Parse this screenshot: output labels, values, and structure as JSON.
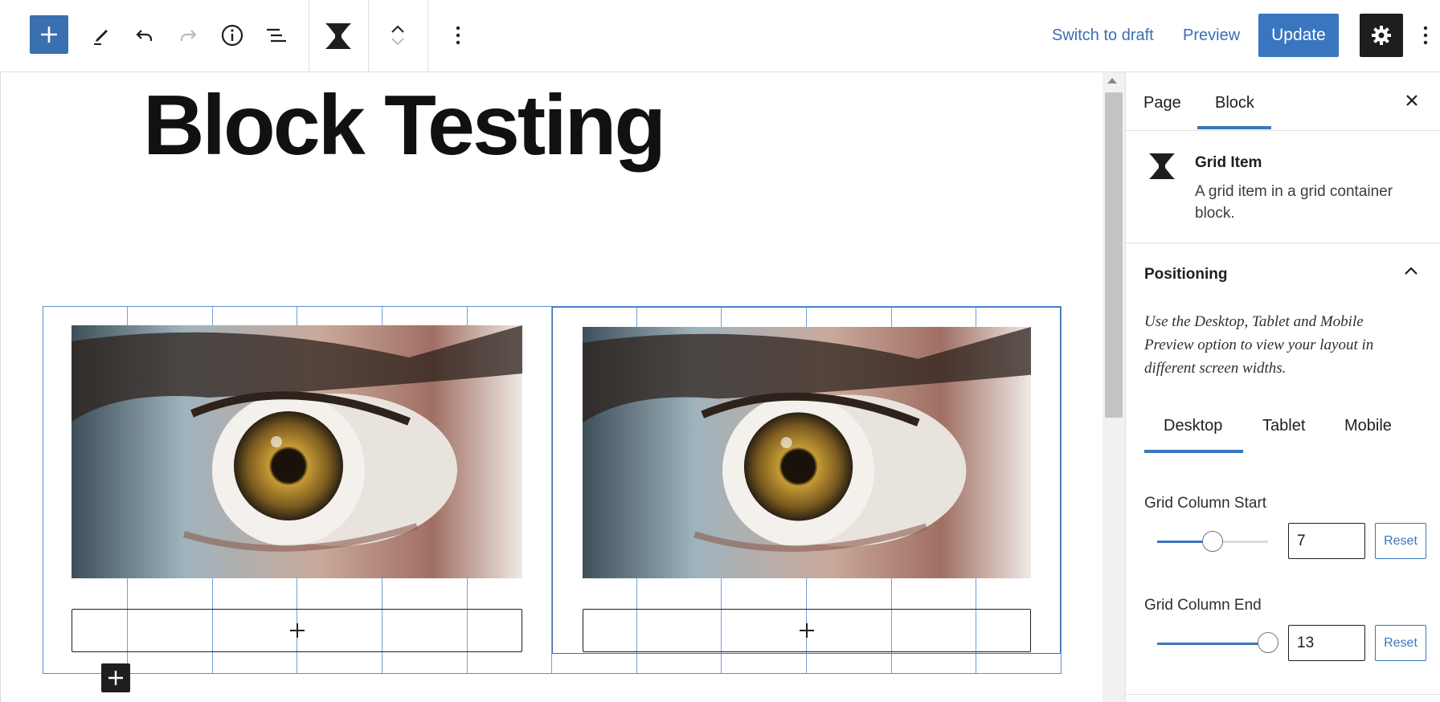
{
  "toolbar": {
    "inserter_icon": "plus-icon",
    "tools_icon": "pencil-icon",
    "undo_icon": "undo-icon",
    "redo_icon": "redo-icon",
    "info_icon": "info-icon",
    "list_view_icon": "list-view-icon",
    "block_icon": "hourglass-icon",
    "move_icon": "chevron-up-down-icon",
    "more_icon": "more-vertical-icon",
    "switch_to_draft": "Switch to draft",
    "preview": "Preview",
    "update": "Update",
    "settings_icon": "gear-icon",
    "options_icon": "more-vertical-icon"
  },
  "canvas": {
    "title": "Block Testing",
    "grid_items": [
      {
        "image": "eye-photo",
        "appender_icon": "plus-icon"
      },
      {
        "image": "eye-photo",
        "appender_icon": "plus-icon"
      }
    ]
  },
  "sidebar": {
    "tabs": [
      {
        "label": "Page",
        "active": false
      },
      {
        "label": "Block",
        "active": true
      }
    ],
    "close_icon": "close-icon",
    "block": {
      "name": "Grid Item",
      "description": "A grid item in a grid container block."
    },
    "panel": {
      "title": "Positioning",
      "help": "Use the Desktop, Tablet and Mobile Preview option to view your layout in different screen widths.",
      "device_tabs": [
        {
          "label": "Desktop",
          "active": true
        },
        {
          "label": "Tablet",
          "active": false
        },
        {
          "label": "Mobile",
          "active": false
        }
      ],
      "column_start": {
        "label": "Grid Column Start",
        "value": "7",
        "reset": "Reset",
        "slider_fraction": 0.5
      },
      "column_end": {
        "label": "Grid Column End",
        "value": "13",
        "reset": "Reset",
        "slider_fraction": 1.0
      }
    }
  },
  "colors": {
    "accent": "#3a75bf",
    "grid_lines": "#5b8fd3",
    "dark": "#1e1e1e"
  }
}
